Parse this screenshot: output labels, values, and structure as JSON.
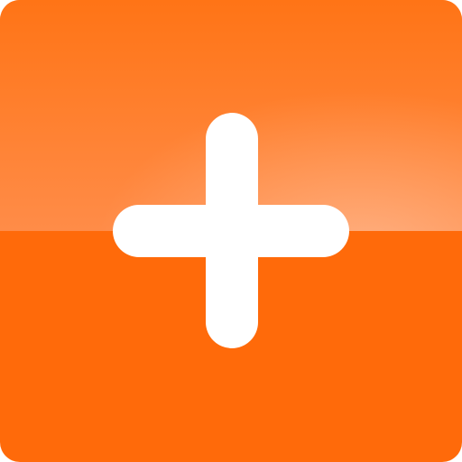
{
  "add_button": {
    "icon": "plus-icon",
    "colors": {
      "base": "#ff6a0a",
      "gloss_top": "#ff7416",
      "gloss_bottom": "#ff8c48",
      "symbol": "#ffffff"
    }
  }
}
